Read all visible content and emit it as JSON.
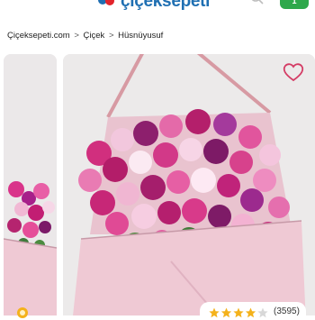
{
  "header": {
    "logo_text": "çiçeksepeti",
    "cart_count": "1"
  },
  "breadcrumb": {
    "items": [
      "Çiçeksepeti.com",
      "Çiçek",
      "Hüsnüyusuf"
    ],
    "separator": ">"
  },
  "product": {
    "rating_value": 4,
    "rating_max": 5,
    "review_count": "(3595)"
  },
  "colors": {
    "brand_blue": "#1f6fb2",
    "brand_red": "#e2242b",
    "cart_green": "#2ea84b",
    "wrap_pink": "#efc9d4",
    "star_gold": "#f4b21b",
    "heart": "#d43b64"
  },
  "icons": {
    "logo": "flower-logo-icon",
    "search": "search-icon",
    "cart": "cart-icon",
    "favorite": "heart-icon",
    "rating": "star-icon"
  }
}
